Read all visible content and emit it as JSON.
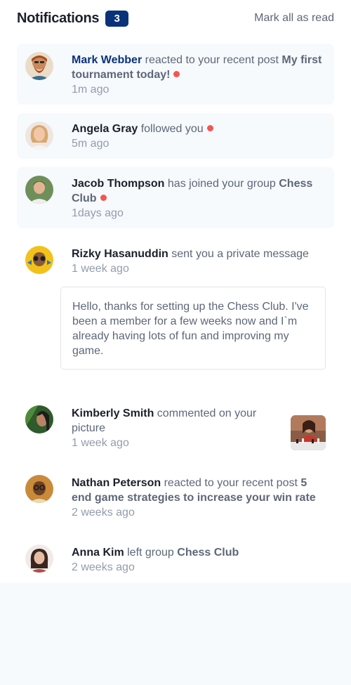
{
  "header": {
    "title": "Notifications",
    "unread_count": "3",
    "mark_all_label": "Mark all as read"
  },
  "notifications": [
    {
      "name": "Mark Webber",
      "action": " reacted to your recent post ",
      "target": "My first tournament today!",
      "time": "1m ago",
      "unread": true,
      "avatar_icon": "avatar-mark-webber"
    },
    {
      "name": "Angela Gray",
      "action": " followed you",
      "target": "",
      "time": "5m ago",
      "unread": true,
      "avatar_icon": "avatar-angela-gray"
    },
    {
      "name": "Jacob Thompson",
      "action": " has joined your group ",
      "target": "Chess Club",
      "time": "1days ago",
      "unread": true,
      "avatar_icon": "avatar-jacob-thompson"
    },
    {
      "name": "Rizky Hasanuddin",
      "action": " sent you a private message",
      "target": "",
      "time": "1 week ago",
      "unread": false,
      "avatar_icon": "avatar-rizky-hasanuddin",
      "message": "Hello, thanks for setting up the Chess Club. I've been a member for a few weeks now and I`m already having lots of fun and improving my game."
    },
    {
      "name": "Kimberly Smith",
      "action": " commented on your picture",
      "target": "",
      "time": "1 week ago",
      "unread": false,
      "avatar_icon": "avatar-kimberly-smith",
      "picture_icon": "chess-picture"
    },
    {
      "name": "Nathan Peterson",
      "action": " reacted to your recent post ",
      "target": "5 end game strategies to increase your win rate",
      "time": "2 weeks ago",
      "unread": false,
      "avatar_icon": "avatar-nathan-peterson"
    },
    {
      "name": "Anna Kim",
      "action": " left group ",
      "target": "Chess Club",
      "time": "2 weeks ago",
      "unread": false,
      "avatar_icon": "avatar-anna-kim"
    }
  ],
  "colors": {
    "badge": "#0a327b",
    "unread_bg": "#f6fafd",
    "unread_dot": "#f65552",
    "heading": "#1c202b",
    "body_text": "#5e6778",
    "muted_text": "#939cad"
  }
}
